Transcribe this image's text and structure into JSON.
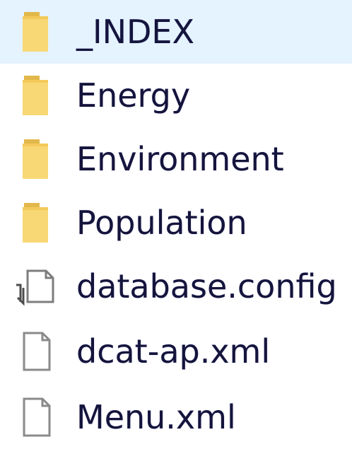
{
  "items": [
    {
      "name": "_INDEX",
      "icon": "folder-icon"
    },
    {
      "name": "Energy",
      "icon": "folder-icon"
    },
    {
      "name": "Environment",
      "icon": "folder-icon"
    },
    {
      "name": "Population",
      "icon": "folder-icon"
    },
    {
      "name": "database.config",
      "icon": "shortcut-file-icon"
    },
    {
      "name": "dcat-ap.xml",
      "icon": "file-icon"
    },
    {
      "name": "Menu.xml",
      "icon": "file-icon"
    }
  ],
  "colors": {
    "folder": "#f8d775",
    "folder_dark": "#e2b84a",
    "text": "#14143c",
    "file_border": "#8a8a8a"
  }
}
